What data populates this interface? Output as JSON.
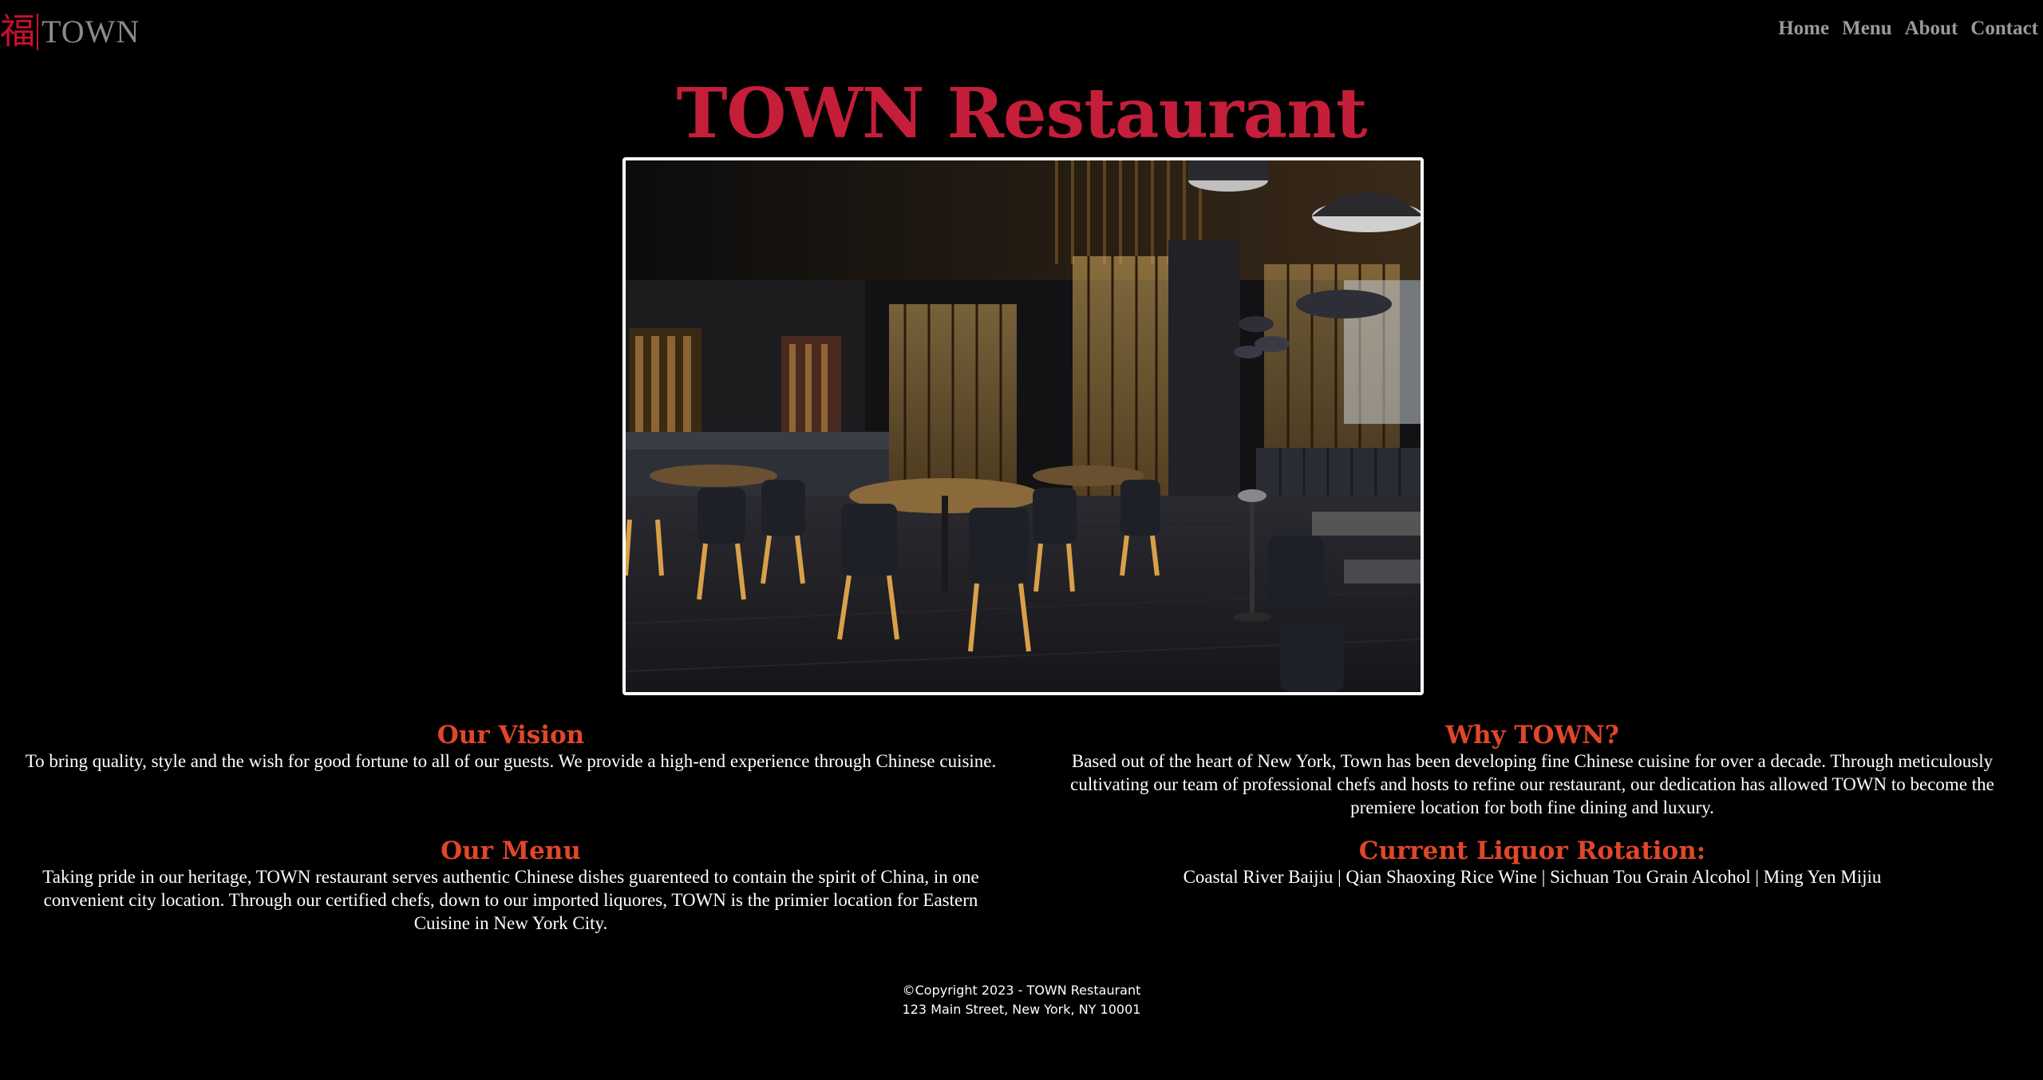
{
  "nav": {
    "logo_glyph": "福",
    "logo_text": "TOWN",
    "links": [
      "Home",
      "Menu",
      "About",
      "Contact"
    ]
  },
  "page_title": "TOWN Restaurant",
  "sections": {
    "vision": {
      "heading": "Our Vision",
      "body": "To bring quality, style and the wish for good fortune to all of our guests. We provide a high-end experience through Chinese cuisine."
    },
    "why": {
      "heading": "Why TOWN?",
      "body": "Based out of the heart of New York, Town has been developing fine Chinese cuisine for over a decade. Through meticulously cultivating our team of professional chefs and hosts to refine our restaurant, our dedication has allowed TOWN to become the premiere location for both fine dining and luxury."
    },
    "menu": {
      "heading": "Our Menu",
      "body": "Taking pride in our heritage, TOWN restaurant serves authentic Chinese dishes guarenteed to contain the spirit of China, in one convenient city location. Through our certified chefs, down to our imported liquores, TOWN is the primier location for Eastern Cuisine in New York City."
    },
    "liquor": {
      "heading": "Current Liquor Rotation:",
      "body": "Coastal River Baijiu | Qian Shaoxing Rice Wine | Sichuan Tou Grain Alcohol | Ming Yen Mijiu"
    }
  },
  "footer": {
    "copyright": "©Copyright 2023 - TOWN Restaurant",
    "address": "123 Main Street, New York, NY 10001"
  },
  "colors": {
    "title_red": "#c41e3a",
    "heading_orange": "#e0462a",
    "background": "#000000"
  }
}
